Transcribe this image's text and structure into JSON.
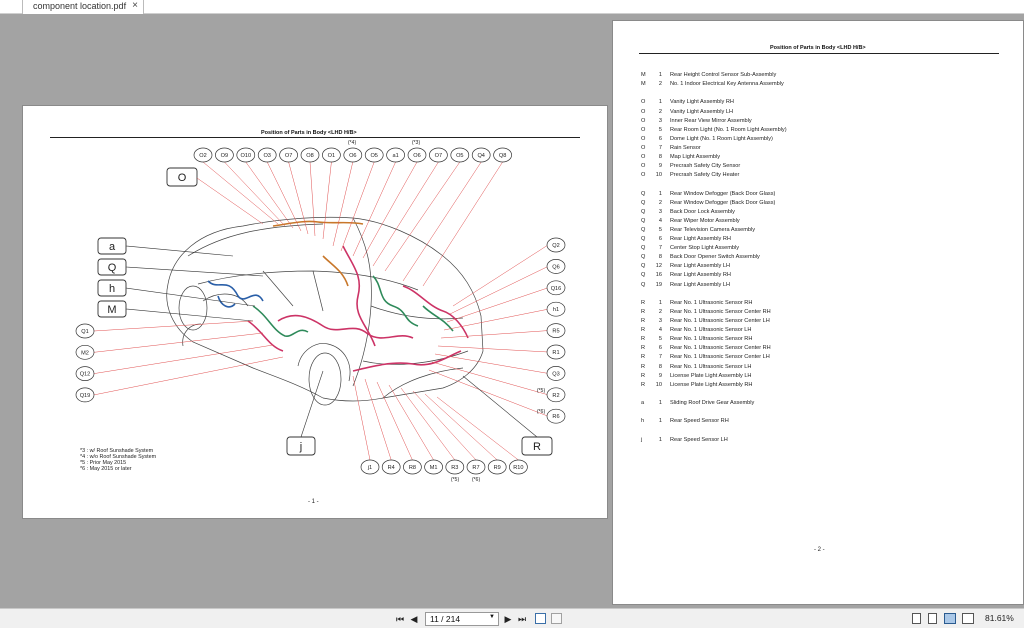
{
  "tab": {
    "title": "component location.pdf",
    "close": "×"
  },
  "page1": {
    "title": "Position of Parts in Body <LHD H/B>",
    "page_number": "- 1 -",
    "notes": [
      "*3 : w/ Roof Sunshade System",
      "*4 : w/o Roof Sunshade System",
      "*5 : Prior May 2015",
      "*6 : May 2015 or later"
    ],
    "top_callouts": [
      "O2",
      "O9",
      "O10",
      "O3",
      "O7",
      "O8",
      "O1",
      "O6",
      "O5",
      "a1",
      "O6",
      "O7",
      "O5",
      "Q4",
      "Q8"
    ],
    "top_marks": {
      "O6": "(*4)",
      "O6b": "(*3)"
    },
    "big_labels_left": [
      "a",
      "Q",
      "h",
      "M"
    ],
    "big_label_top": "O",
    "big_label_j": "j",
    "big_label_R": "R",
    "left_callouts": [
      "Q1",
      "M2",
      "Q12",
      "Q19"
    ],
    "right_callouts": [
      "Q2",
      "Q6",
      "Q16",
      "h1",
      "R5",
      "R1",
      "Q3",
      "R2",
      "R6"
    ],
    "right_marks": {
      "R2": "(*5)",
      "R6": "(*6)"
    },
    "bottom_callouts": [
      "j1",
      "R4",
      "R8",
      "M1",
      "R3",
      "R7",
      "R9",
      "R10"
    ],
    "bottom_marks": {
      "R3": "(*5)",
      "R7": "(*6)"
    }
  },
  "page2": {
    "title": "Position of Parts in Body <LHD H/B>",
    "page_number": "- 2 -",
    "groups": [
      [
        [
          "M",
          "1",
          "Rear Height Control Sensor Sub-Assembly"
        ],
        [
          "M",
          "2",
          "No. 1 Indoor Electrical Key Antenna Assembly"
        ]
      ],
      [
        [
          "O",
          "1",
          "Vanity Light Assembly RH"
        ],
        [
          "O",
          "2",
          "Vanity Light Assembly LH"
        ],
        [
          "O",
          "3",
          "Inner Rear View Mirror Assembly"
        ],
        [
          "O",
          "5",
          "Rear Room Light (No. 1 Room Light Assembly)"
        ],
        [
          "O",
          "6",
          "Dome Light (No. 1 Room Light Assembly)"
        ],
        [
          "O",
          "7",
          "Rain Sensor"
        ],
        [
          "O",
          "8",
          "Map Light Assembly"
        ],
        [
          "O",
          "9",
          "Precrash Safety City Sensor"
        ],
        [
          "O",
          "10",
          "Precrash Safety City Heater"
        ]
      ],
      [
        [
          "Q",
          "1",
          "Rear Window Defogger (Back Door Glass)"
        ],
        [
          "Q",
          "2",
          "Rear Window Defogger (Back Door Glass)"
        ],
        [
          "Q",
          "3",
          "Back Door Lock Assembly"
        ],
        [
          "Q",
          "4",
          "Rear Wiper Motor Assembly"
        ],
        [
          "Q",
          "5",
          "Rear Television Camera Assembly"
        ],
        [
          "Q",
          "6",
          "Rear Light Assembly RH"
        ],
        [
          "Q",
          "7",
          "Center Stop Light Assembly"
        ],
        [
          "Q",
          "8",
          "Back Door Opener Switch Assembly"
        ],
        [
          "Q",
          "12",
          "Rear Light Assembly LH"
        ],
        [
          "Q",
          "16",
          "Rear Light Assembly RH"
        ],
        [
          "Q",
          "19",
          "Rear Light Assembly LH"
        ]
      ],
      [
        [
          "R",
          "1",
          "Rear No. 1 Ultrasonic Sensor RH"
        ],
        [
          "R",
          "2",
          "Rear No. 1 Ultrasonic Sensor Center RH"
        ],
        [
          "R",
          "3",
          "Rear No. 1 Ultrasonic Sensor Center LH"
        ],
        [
          "R",
          "4",
          "Rear No. 1 Ultrasonic Sensor LH"
        ],
        [
          "R",
          "5",
          "Rear No. 1 Ultrasonic Sensor RH"
        ],
        [
          "R",
          "6",
          "Rear No. 1 Ultrasonic Sensor Center RH"
        ],
        [
          "R",
          "7",
          "Rear No. 1 Ultrasonic Sensor Center LH"
        ],
        [
          "R",
          "8",
          "Rear No. 1 Ultrasonic Sensor LH"
        ],
        [
          "R",
          "9",
          "License Plate Light Assembly LH"
        ],
        [
          "R",
          "10",
          "License Plate Light Assembly RH"
        ]
      ],
      [
        [
          "a",
          "1",
          "Sliding Roof Drive Gear Assembly"
        ]
      ],
      [
        [
          "h",
          "1",
          "Rear Speed Sensor RH"
        ]
      ],
      [
        [
          "j",
          "1",
          "Rear Speed Sensor LH"
        ]
      ]
    ]
  },
  "toolbar": {
    "first": "⏮",
    "prev": "◀",
    "next": "▶",
    "last": "⏭",
    "page_value": "11 / 214",
    "zoom": "81.61%"
  },
  "colors": {
    "leader": "#e05050",
    "harness_blue": "#2a5fa8",
    "harness_pink": "#cc3366",
    "harness_green": "#2e8a5a",
    "harness_orange": "#c8772a"
  }
}
